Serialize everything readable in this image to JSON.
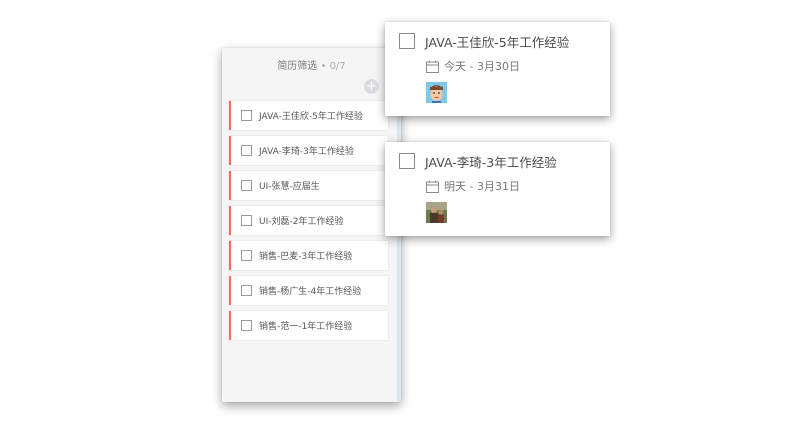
{
  "column": {
    "title": "简历筛选",
    "count": " • 0/7",
    "add_label": "+"
  },
  "tasks": [
    {
      "title": "JAVA-王佳欣-5年工作经验"
    },
    {
      "title": "JAVA-李琦-3年工作经验"
    },
    {
      "title": "UI-张慧-应届生"
    },
    {
      "title": "UI-刘磊-2年工作经验"
    },
    {
      "title": "销售-巴麦-3年工作经验"
    },
    {
      "title": "销售-杨广生-4年工作经验"
    },
    {
      "title": "销售-范一-1年工作经验"
    }
  ],
  "detail_cards": [
    {
      "title": "JAVA-王佳欣-5年工作经验",
      "due": "今天 - 3月30日",
      "avatar_icon": "avatar-man-cartoon-icon"
    },
    {
      "title": "JAVA-李琦-3年工作经验",
      "due": "明天 - 3月31日",
      "avatar_icon": "avatar-photo-icon"
    }
  ],
  "colors": {
    "accent_border": "#ef6b63",
    "column_bg": "#f5f5f5",
    "scrollbar": "#dbe6f1"
  }
}
